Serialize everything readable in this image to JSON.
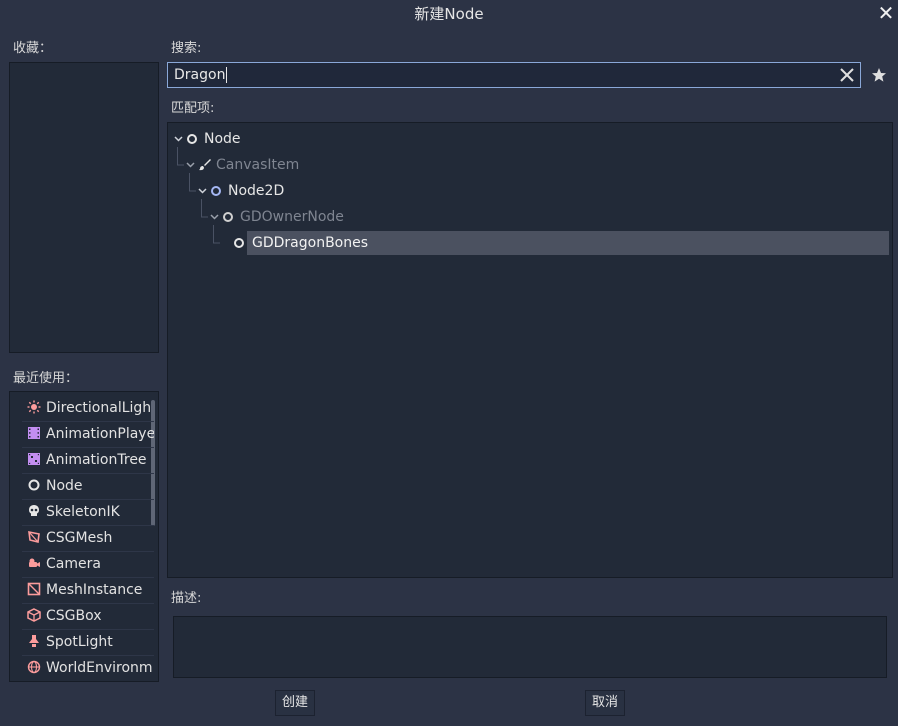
{
  "dialog": {
    "title": "新建Node",
    "close_label": "✕"
  },
  "favorites": {
    "label": "收藏："
  },
  "recent": {
    "label": "最近使用：",
    "items": [
      {
        "label": "DirectionalLigh",
        "icon": "directional-light-icon"
      },
      {
        "label": "AnimationPlaye",
        "icon": "animation-player-icon"
      },
      {
        "label": "AnimationTree",
        "icon": "animation-tree-icon"
      },
      {
        "label": "Node",
        "icon": "node-icon"
      },
      {
        "label": "SkeletonIK",
        "icon": "skeleton-ik-icon"
      },
      {
        "label": "CSGMesh",
        "icon": "csg-mesh-icon"
      },
      {
        "label": "Camera",
        "icon": "camera-icon"
      },
      {
        "label": "MeshInstance",
        "icon": "mesh-instance-icon"
      },
      {
        "label": "CSGBox",
        "icon": "csg-box-icon"
      },
      {
        "label": "SpotLight",
        "icon": "spot-light-icon"
      },
      {
        "label": "WorldEnvironm",
        "icon": "world-environment-icon"
      }
    ]
  },
  "search": {
    "label": "搜索:",
    "value": "Dragon"
  },
  "matches": {
    "label": "匹配项:",
    "tree": [
      {
        "label": "Node",
        "dimmed": false
      },
      {
        "label": "CanvasItem",
        "dimmed": true
      },
      {
        "label": "Node2D",
        "dimmed": false
      },
      {
        "label": "GDOwnerNode",
        "dimmed": true
      },
      {
        "label": "GDDragonBones",
        "dimmed": false,
        "selected": true
      }
    ]
  },
  "description": {
    "label": "描述:",
    "text": ""
  },
  "buttons": {
    "create": "创建",
    "cancel": "取消"
  },
  "colors": {
    "accent": "#8aa8d8",
    "background": "#2c3345",
    "panel": "#222a38",
    "selected_row": "#4b5160",
    "node2d_blue": "#a5b7f3",
    "spatial_red": "#fc9c9c",
    "anim_purple": "#c38ef1"
  }
}
